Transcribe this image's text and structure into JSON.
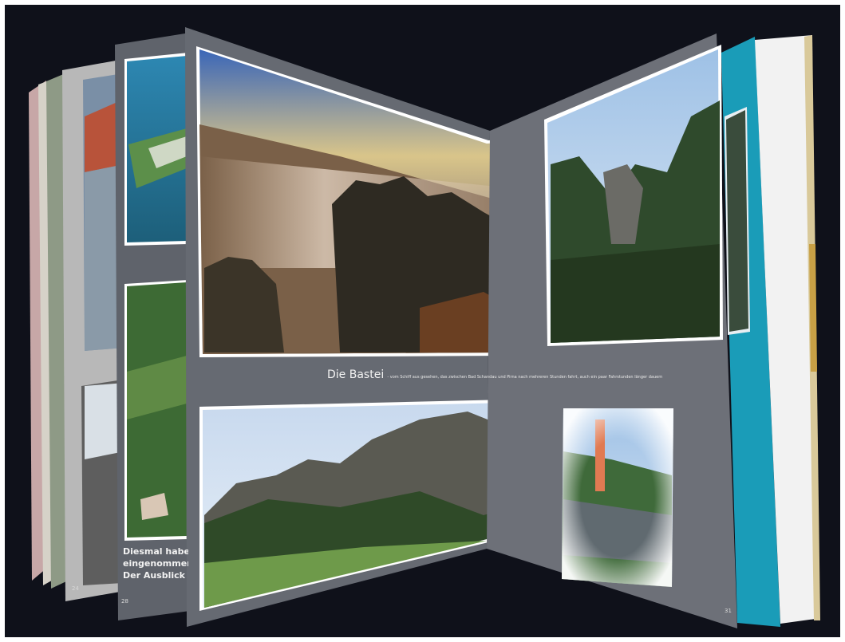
{
  "caption": {
    "title": "Die Bastei",
    "subtitle": "- vom Schiff aus gesehen, das zwischen Bad Schandau und Pirna nach mehreren Stunden fahrt, auch ein paar Fahrstunden länger dauern"
  },
  "left_page_text": {
    "line1": "Diesmal haben",
    "line2": "eingenommen w",
    "line3": "Der Ausblick is"
  },
  "page_numbers": {
    "p24": "24",
    "p28": "28",
    "p31": "31"
  },
  "colors": {
    "background": "#0f111a",
    "page_gray": "#6a6e76",
    "teal_cover": "#1a9cb8",
    "caption_text": "#f2f2f2"
  }
}
